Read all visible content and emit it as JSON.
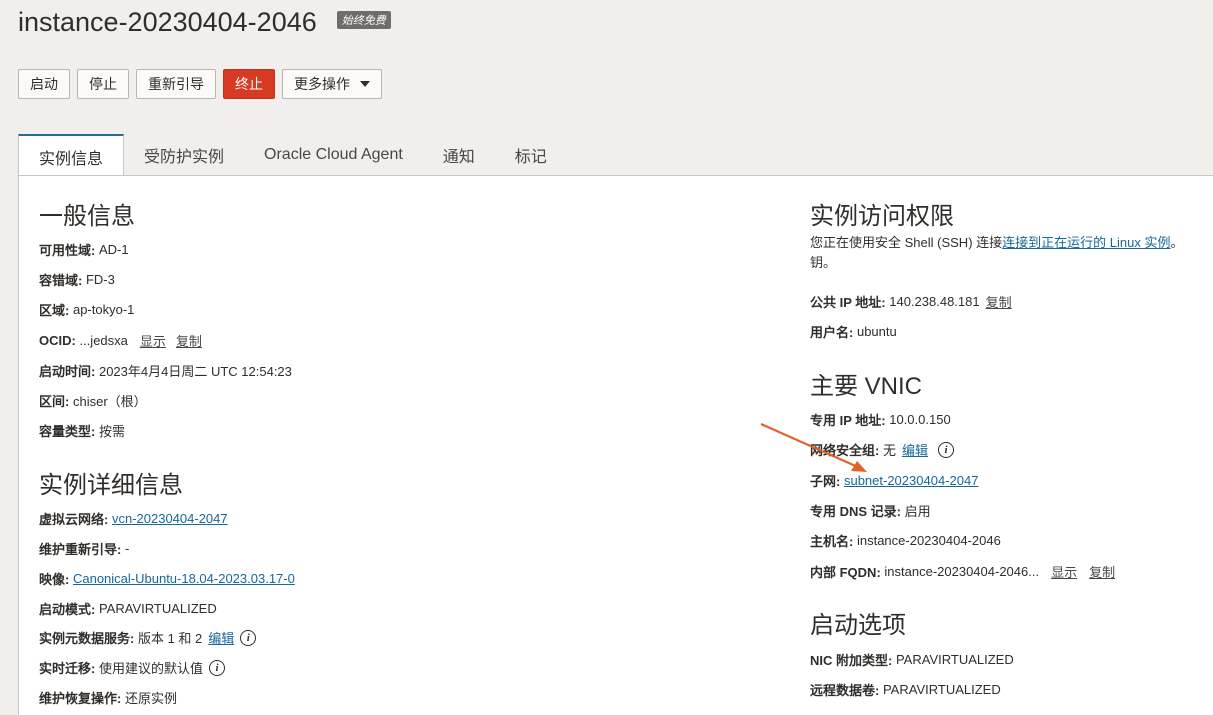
{
  "header": {
    "title": "instance-20230404-2046",
    "badge": "始终免费"
  },
  "toolbar": {
    "start": "启动",
    "stop": "停止",
    "reboot": "重新引导",
    "terminate": "终止",
    "more": "更多操作"
  },
  "tabs": [
    "实例信息",
    "受防护实例",
    "Oracle Cloud Agent",
    "通知",
    "标记"
  ],
  "general": {
    "heading": "一般信息",
    "ad_label": "可用性域:",
    "ad_value": "AD-1",
    "fd_label": "容错域:",
    "fd_value": "FD-3",
    "region_label": "区域:",
    "region_value": "ap-tokyo-1",
    "ocid_label": "OCID:",
    "ocid_value": "...jedsxa",
    "ocid_show": "显示",
    "ocid_copy": "复制",
    "launched_label": "启动时间:",
    "launched_value": "2023年4月4日周二 UTC 12:54:23",
    "compartment_label": "区间:",
    "compartment_value": "chiser（根）",
    "capacity_label": "容量类型:",
    "capacity_value": "按需"
  },
  "details": {
    "heading": "实例详细信息",
    "vcn_label": "虚拟云网络:",
    "vcn_value": "vcn-20230404-2047",
    "maint_label": "维护重新引导:",
    "maint_value": "-",
    "image_label": "映像:",
    "image_value": "Canonical-Ubuntu-18.04-2023.03.17-0",
    "launch_mode_label": "启动模式:",
    "launch_mode_value": "PARAVIRTUALIZED",
    "metadata_label": "实例元数据服务:",
    "metadata_value": "版本 1 和 2",
    "metadata_edit": "编辑",
    "migration_label": "实时迁移:",
    "migration_value": "使用建议的默认值",
    "recovery_label": "维护恢复操作:",
    "recovery_value": "还原实例"
  },
  "access": {
    "heading": "实例访问权限",
    "desc_prefix": "您正在使用安全 Shell (SSH) 连接",
    "desc_link": "连接到正在运行的 Linux 实例",
    "desc_suffix": "。",
    "desc_line2": "钥。",
    "ip_label": "公共 IP 地址:",
    "ip_value": "140.238.48.181",
    "ip_copy": "复制",
    "user_label": "用户名:",
    "user_value": "ubuntu"
  },
  "vnic": {
    "heading": "主要 VNIC",
    "private_ip_label": "专用 IP 地址:",
    "private_ip_value": "10.0.0.150",
    "nsg_label": "网络安全组:",
    "nsg_value": "无",
    "nsg_edit": "编辑",
    "subnet_label": "子网:",
    "subnet_value": "subnet-20230404-2047",
    "dns_label": "专用 DNS 记录:",
    "dns_value": "启用",
    "host_label": "主机名:",
    "host_value": "instance-20230404-2046",
    "fqdn_label": "内部 FQDN:",
    "fqdn_value": "instance-20230404-2046...",
    "fqdn_show": "显示",
    "fqdn_copy": "复制"
  },
  "launch_options": {
    "heading": "启动选项",
    "nic_label": "NIC 附加类型:",
    "nic_value": "PARAVIRTUALIZED",
    "remote_label": "远程数据卷:",
    "remote_value": "PARAVIRTUALIZED"
  },
  "colors": {
    "link": "#16689a",
    "danger": "#d73a22",
    "arrow": "#e0622a",
    "background": "#f1efed"
  }
}
